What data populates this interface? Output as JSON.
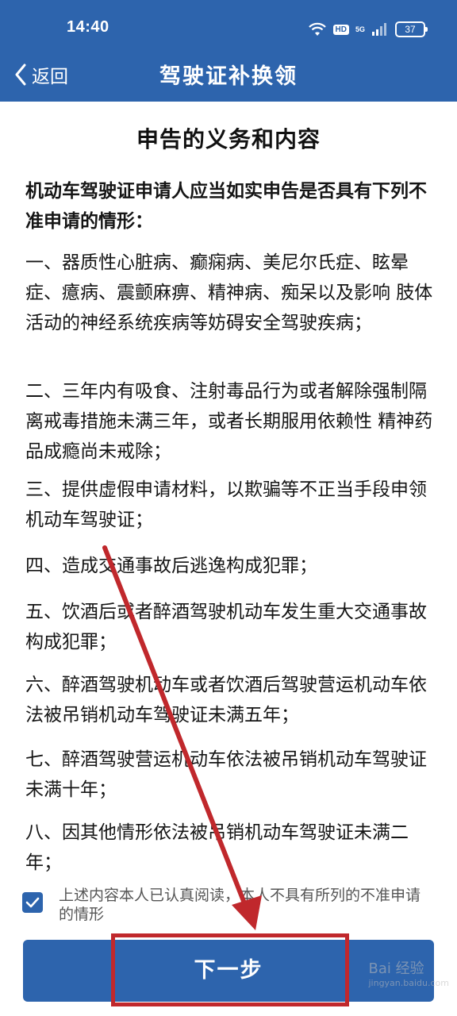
{
  "status_bar": {
    "time": "14:40",
    "hd": "HD",
    "network": "5G",
    "battery": "37"
  },
  "nav": {
    "back_label": "返回",
    "title": "驾驶证补换领"
  },
  "page": {
    "title": "申告的义务和内容",
    "intro": "机动车驾驶证申请人应当如实申告是否具有下列不准申请的情形：",
    "items": [
      "一、器质性心脏病、癫痫病、美尼尔氏症、眩晕症、癔病、震颤麻痹、精神病、痴呆以及影响 肢体活动的神经系统疾病等妨碍安全驾驶疾病；",
      "二、三年内有吸食、注射毒品行为或者解除强制隔离戒毒措施未满三年，或者长期服用依赖性 精神药品成瘾尚未戒除；",
      "三、提供虚假申请材料，以欺骗等不正当手段申领机动车驾驶证；",
      "四、造成交通事故后逃逸构成犯罪；",
      "五、饮酒后或者醉酒驾驶机动车发生重大交通事故构成犯罪；",
      "六、醉酒驾驶机动车或者饮酒后驾驶营运机动车依法被吊销机动车驾驶证未满五年；",
      "七、醉酒驾驶营运机动车依法被吊销机动车驾驶证未满十年；",
      "八、因其他情形依法被吊销机动车驾驶证未满二年；"
    ]
  },
  "agreement": {
    "checked": true,
    "text": "上述内容本人已认真阅读，本人不具有所列的不准申请的情形"
  },
  "next_button": {
    "label": "下一步"
  },
  "watermark": {
    "text": "Bai 经验",
    "sub": "jingyan.baidu.com"
  },
  "colors": {
    "primary": "#2d64ad",
    "annotation": "#c0282c"
  }
}
